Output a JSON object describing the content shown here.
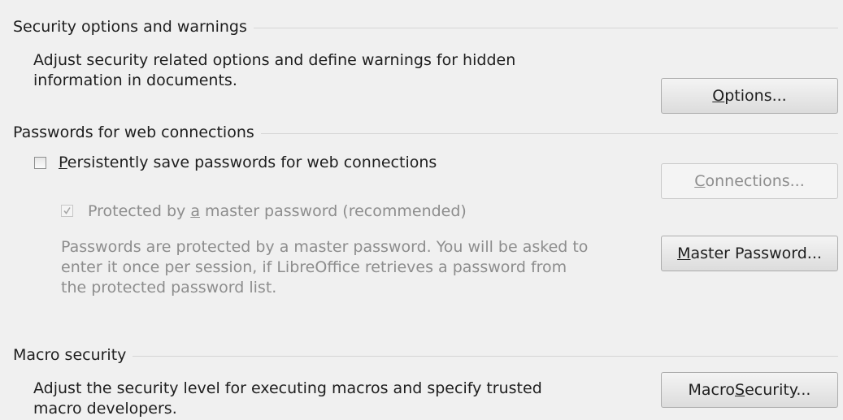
{
  "security": {
    "title": "Security options and warnings",
    "desc_line1": "Adjust security related options and define warnings for hidden",
    "desc_line2": "information in documents.",
    "options_button": {
      "mnemonic": "O",
      "rest": "ptions..."
    }
  },
  "passwords": {
    "title": "Passwords for web connections",
    "persist_checkbox": {
      "checked": false,
      "mnemonic": "P",
      "rest": "ersistently save passwords for web connections"
    },
    "master_checkbox": {
      "checked": true,
      "enabled": false,
      "pre": "Protected by ",
      "mnemonic": "a",
      "post": " master password (recommended)"
    },
    "info_line1": "Passwords are protected by a master password. You will be asked to",
    "info_line2": "enter it once per session, if LibreOffice retrieves a password from",
    "info_line3": "the protected password list.",
    "connections_button": {
      "mnemonic": "C",
      "rest": "onnections...",
      "enabled": false
    },
    "master_password_button": {
      "mnemonic": "M",
      "rest": "aster Password..."
    }
  },
  "macro": {
    "title": "Macro security",
    "desc_line1": "Adjust the security level for executing macros and specify trusted",
    "desc_line2": "macro developers.",
    "macro_security_button": {
      "pre": "Macro ",
      "mnemonic": "S",
      "rest": "ecurity..."
    }
  },
  "colors": {
    "background": "#f0f0f0",
    "text": "#1e1e1e",
    "disabled_text": "#8d8d8d"
  }
}
